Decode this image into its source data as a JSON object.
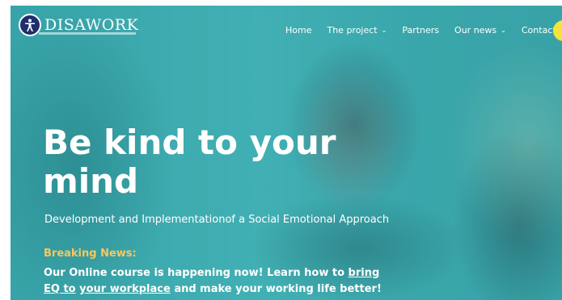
{
  "brand": {
    "name": "DISAWORK",
    "logo_icon": "accessibility-person-icon"
  },
  "nav": {
    "items": [
      {
        "label": "Home",
        "has_dropdown": false
      },
      {
        "label": "The project",
        "has_dropdown": true
      },
      {
        "label": "Partners",
        "has_dropdown": false
      },
      {
        "label": "Our news",
        "has_dropdown": true
      },
      {
        "label": "Contact",
        "has_dropdown": false
      }
    ],
    "dropdown_icon": "chevron-down-icon"
  },
  "hero": {
    "title_line1": "Be kind to your",
    "title_line2": "mind",
    "subtitle": "Development and Implementationof a Social Emotional Approach",
    "breaking_label": "Breaking News:",
    "news_text_1": "Our Online course is happening now! Learn how to ",
    "news_link_1": "bring EQ to",
    "news_text_2": " ",
    "news_link_2": "your workplace",
    "news_text_3": " and make your working life better!"
  },
  "colors": {
    "overlay": "#3ea8ad",
    "breaking": "#f6c85f",
    "logo_badge": "#1f2f6b",
    "cta": "#f5e23a"
  }
}
